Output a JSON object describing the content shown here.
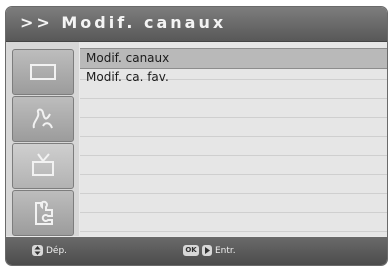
{
  "header": {
    "title": ">> Modif. canaux"
  },
  "sidebar": {
    "items": [
      {
        "icon": "screen-icon"
      },
      {
        "icon": "music-note-icon"
      },
      {
        "icon": "tv-antenna-icon"
      },
      {
        "icon": "puzzle-icon"
      }
    ],
    "active_index": 2
  },
  "menu": {
    "items": [
      {
        "label": "Modif. canaux"
      },
      {
        "label": "Modif. ca. fav."
      }
    ],
    "selected_index": 0
  },
  "footer": {
    "move_label": "Dép.",
    "enter_label": "Entr.",
    "ok_key": "OK"
  }
}
